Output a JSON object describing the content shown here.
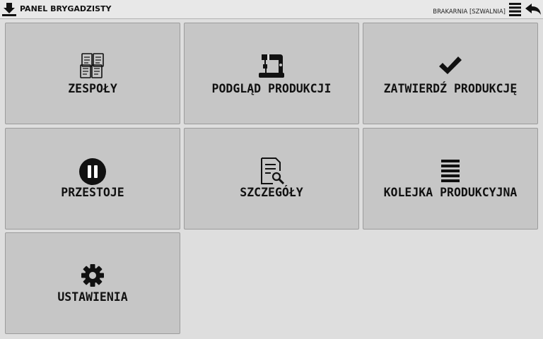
{
  "header": {
    "title": "PANEL BRYGADZISTY",
    "station": "BRAKARNIA [SZWALNIA]",
    "download_icon": "download-icon",
    "menu_icon": "menu-icon",
    "back_icon": "back-arrow-icon"
  },
  "tiles": [
    {
      "label": "ZESPOŁY",
      "icon": "teams-icon"
    },
    {
      "label": "PODGLĄD PRODUKCJI",
      "icon": "sewing-machine-icon"
    },
    {
      "label": "ZATWIERDŹ PRODUKCJĘ",
      "icon": "checkmark-icon"
    },
    {
      "label": "PRZESTOJE",
      "icon": "pause-icon"
    },
    {
      "label": "SZCZEGÓŁY",
      "icon": "document-search-icon"
    },
    {
      "label": "KOLEJKA PRODUKCYJNA",
      "icon": "queue-list-icon"
    },
    {
      "label": "USTAWIENIA",
      "icon": "gear-icon"
    }
  ],
  "colors": {
    "background": "#dedede",
    "tile": "#c6c6c6",
    "tile_border": "#9c9c9c",
    "text": "#111111"
  }
}
